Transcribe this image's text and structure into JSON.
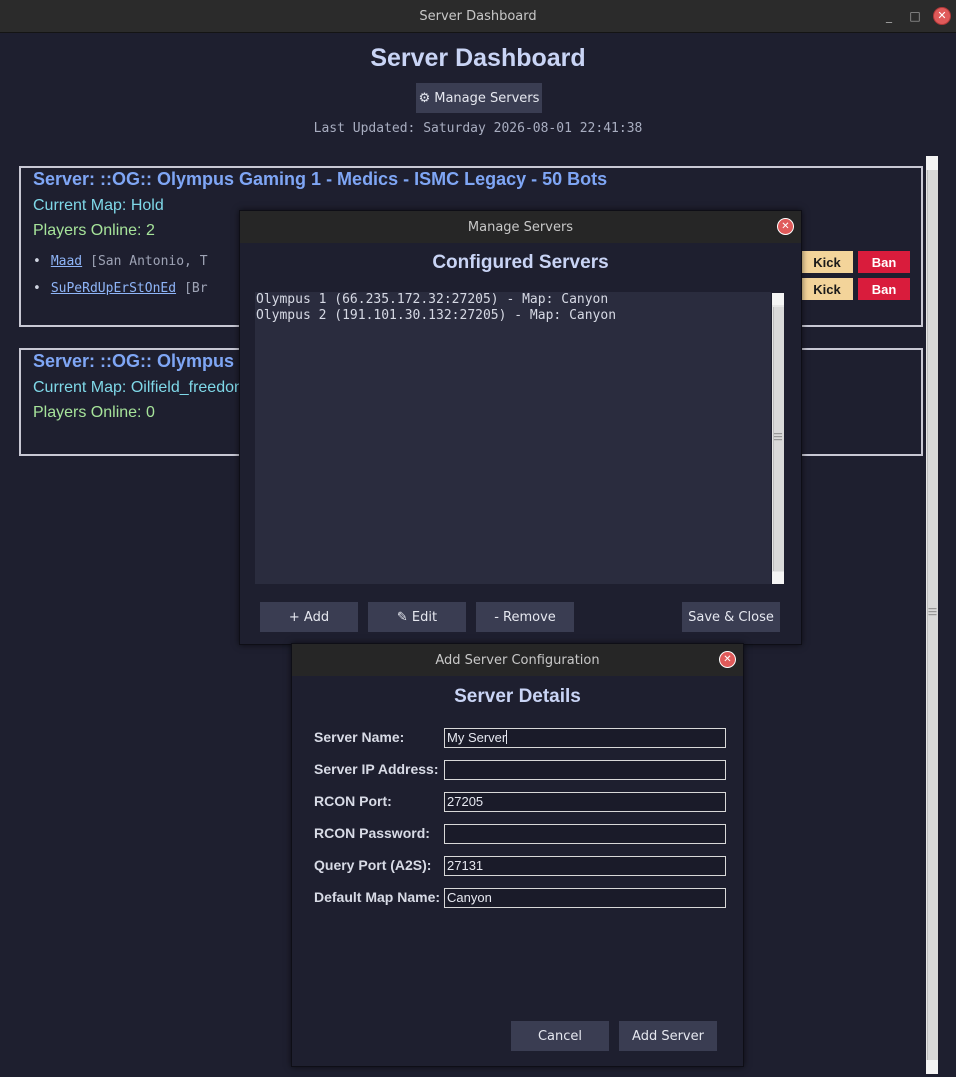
{
  "window": {
    "title": "Server Dashboard"
  },
  "header": {
    "title": "Server Dashboard",
    "manage_button": "Manage Servers",
    "manage_icon": "⚙",
    "last_updated": "Last Updated: Saturday 2026-08-01 22:41:38"
  },
  "servers": [
    {
      "name": "Server: ::OG:: Olympus Gaming 1 - Medics - ISMC Legacy - 50 Bots",
      "map": "Current Map: Hold",
      "players_online": "Players Online: 2",
      "players": [
        {
          "name": "Maad",
          "location": "[San Antonio, T"
        },
        {
          "name": "SuPeRdUpErStOnEd",
          "location": "[Br"
        }
      ]
    },
    {
      "name": "Server: ::OG:: Olympus",
      "map": "Current Map: Oilfield_freedon",
      "players_online": "Players Online: 0",
      "players": []
    }
  ],
  "player_actions": {
    "kick": "Kick",
    "ban": "Ban"
  },
  "manage_dialog": {
    "title": "Manage Servers",
    "heading": "Configured Servers",
    "list": [
      "Olympus 1 (66.235.172.32:27205) - Map: Canyon",
      "Olympus 2 (191.101.30.132:27205) - Map: Canyon"
    ],
    "buttons": {
      "add": "+ Add",
      "edit": "✎ Edit",
      "remove": "- Remove",
      "save": "Save & Close"
    }
  },
  "add_dialog": {
    "title": "Add Server Configuration",
    "heading": "Server Details",
    "fields": [
      {
        "label": "Server Name:",
        "value": "My Server"
      },
      {
        "label": "Server IP Address:",
        "value": ""
      },
      {
        "label": "RCON Port:",
        "value": "27205"
      },
      {
        "label": "RCON Password:",
        "value": ""
      },
      {
        "label": "Query Port (A2S):",
        "value": "27131"
      },
      {
        "label": "Default Map Name:",
        "value": "Canyon"
      }
    ],
    "buttons": {
      "cancel": "Cancel",
      "add": "Add Server"
    }
  },
  "colors": {
    "background": "#1e1f2f",
    "server_name": "#7fa6f5",
    "map": "#7fd8e8",
    "players": "#a6e39a",
    "kick": "#f3d49a",
    "ban": "#d91c3c"
  }
}
